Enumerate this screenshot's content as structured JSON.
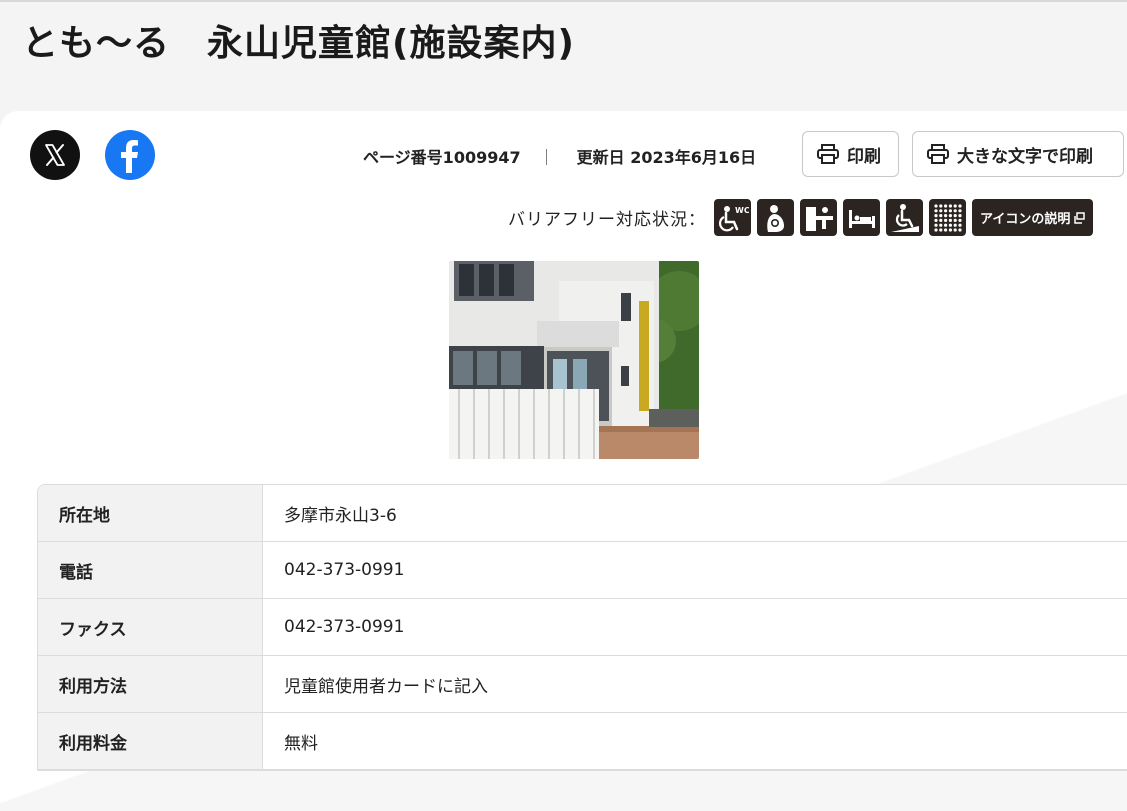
{
  "page": {
    "title": "とも〜る　永山児童館(施設案内)"
  },
  "social": {
    "x_icon": "x-logo-icon",
    "facebook_icon": "facebook-logo-icon"
  },
  "meta": {
    "page_number": "ページ番号1009947",
    "separator": "｜",
    "updated": "更新日 2023年6月16日"
  },
  "print": {
    "print_label": "印刷",
    "large_print_label": "大きな文字で印刷",
    "icon": "printer-icon"
  },
  "barrier_free": {
    "label": "バリアフリー対応状況：",
    "icons": [
      "accessible-toilet-icon",
      "nursing-room-icon",
      "low-counter-icon",
      "bed-icon",
      "ramp-icon",
      "braille-block-icon"
    ],
    "help_label": "アイコンの説明",
    "help_icon": "external-window-icon"
  },
  "photo": {
    "subject": "building-photo"
  },
  "facility": {
    "rows": [
      {
        "label": "所在地",
        "value": "多摩市永山3-6"
      },
      {
        "label": "電話",
        "value": "042-373-0991"
      },
      {
        "label": "ファクス",
        "value": "042-373-0991"
      },
      {
        "label": "利用方法",
        "value": "児童館使用者カードに記入"
      },
      {
        "label": "利用料金",
        "value": "無料"
      }
    ]
  },
  "colors": {
    "icon_dark": "#2b2421",
    "facebook": "#1877f2",
    "background": "#f4f4f4",
    "table_header": "#f2f2f2"
  }
}
